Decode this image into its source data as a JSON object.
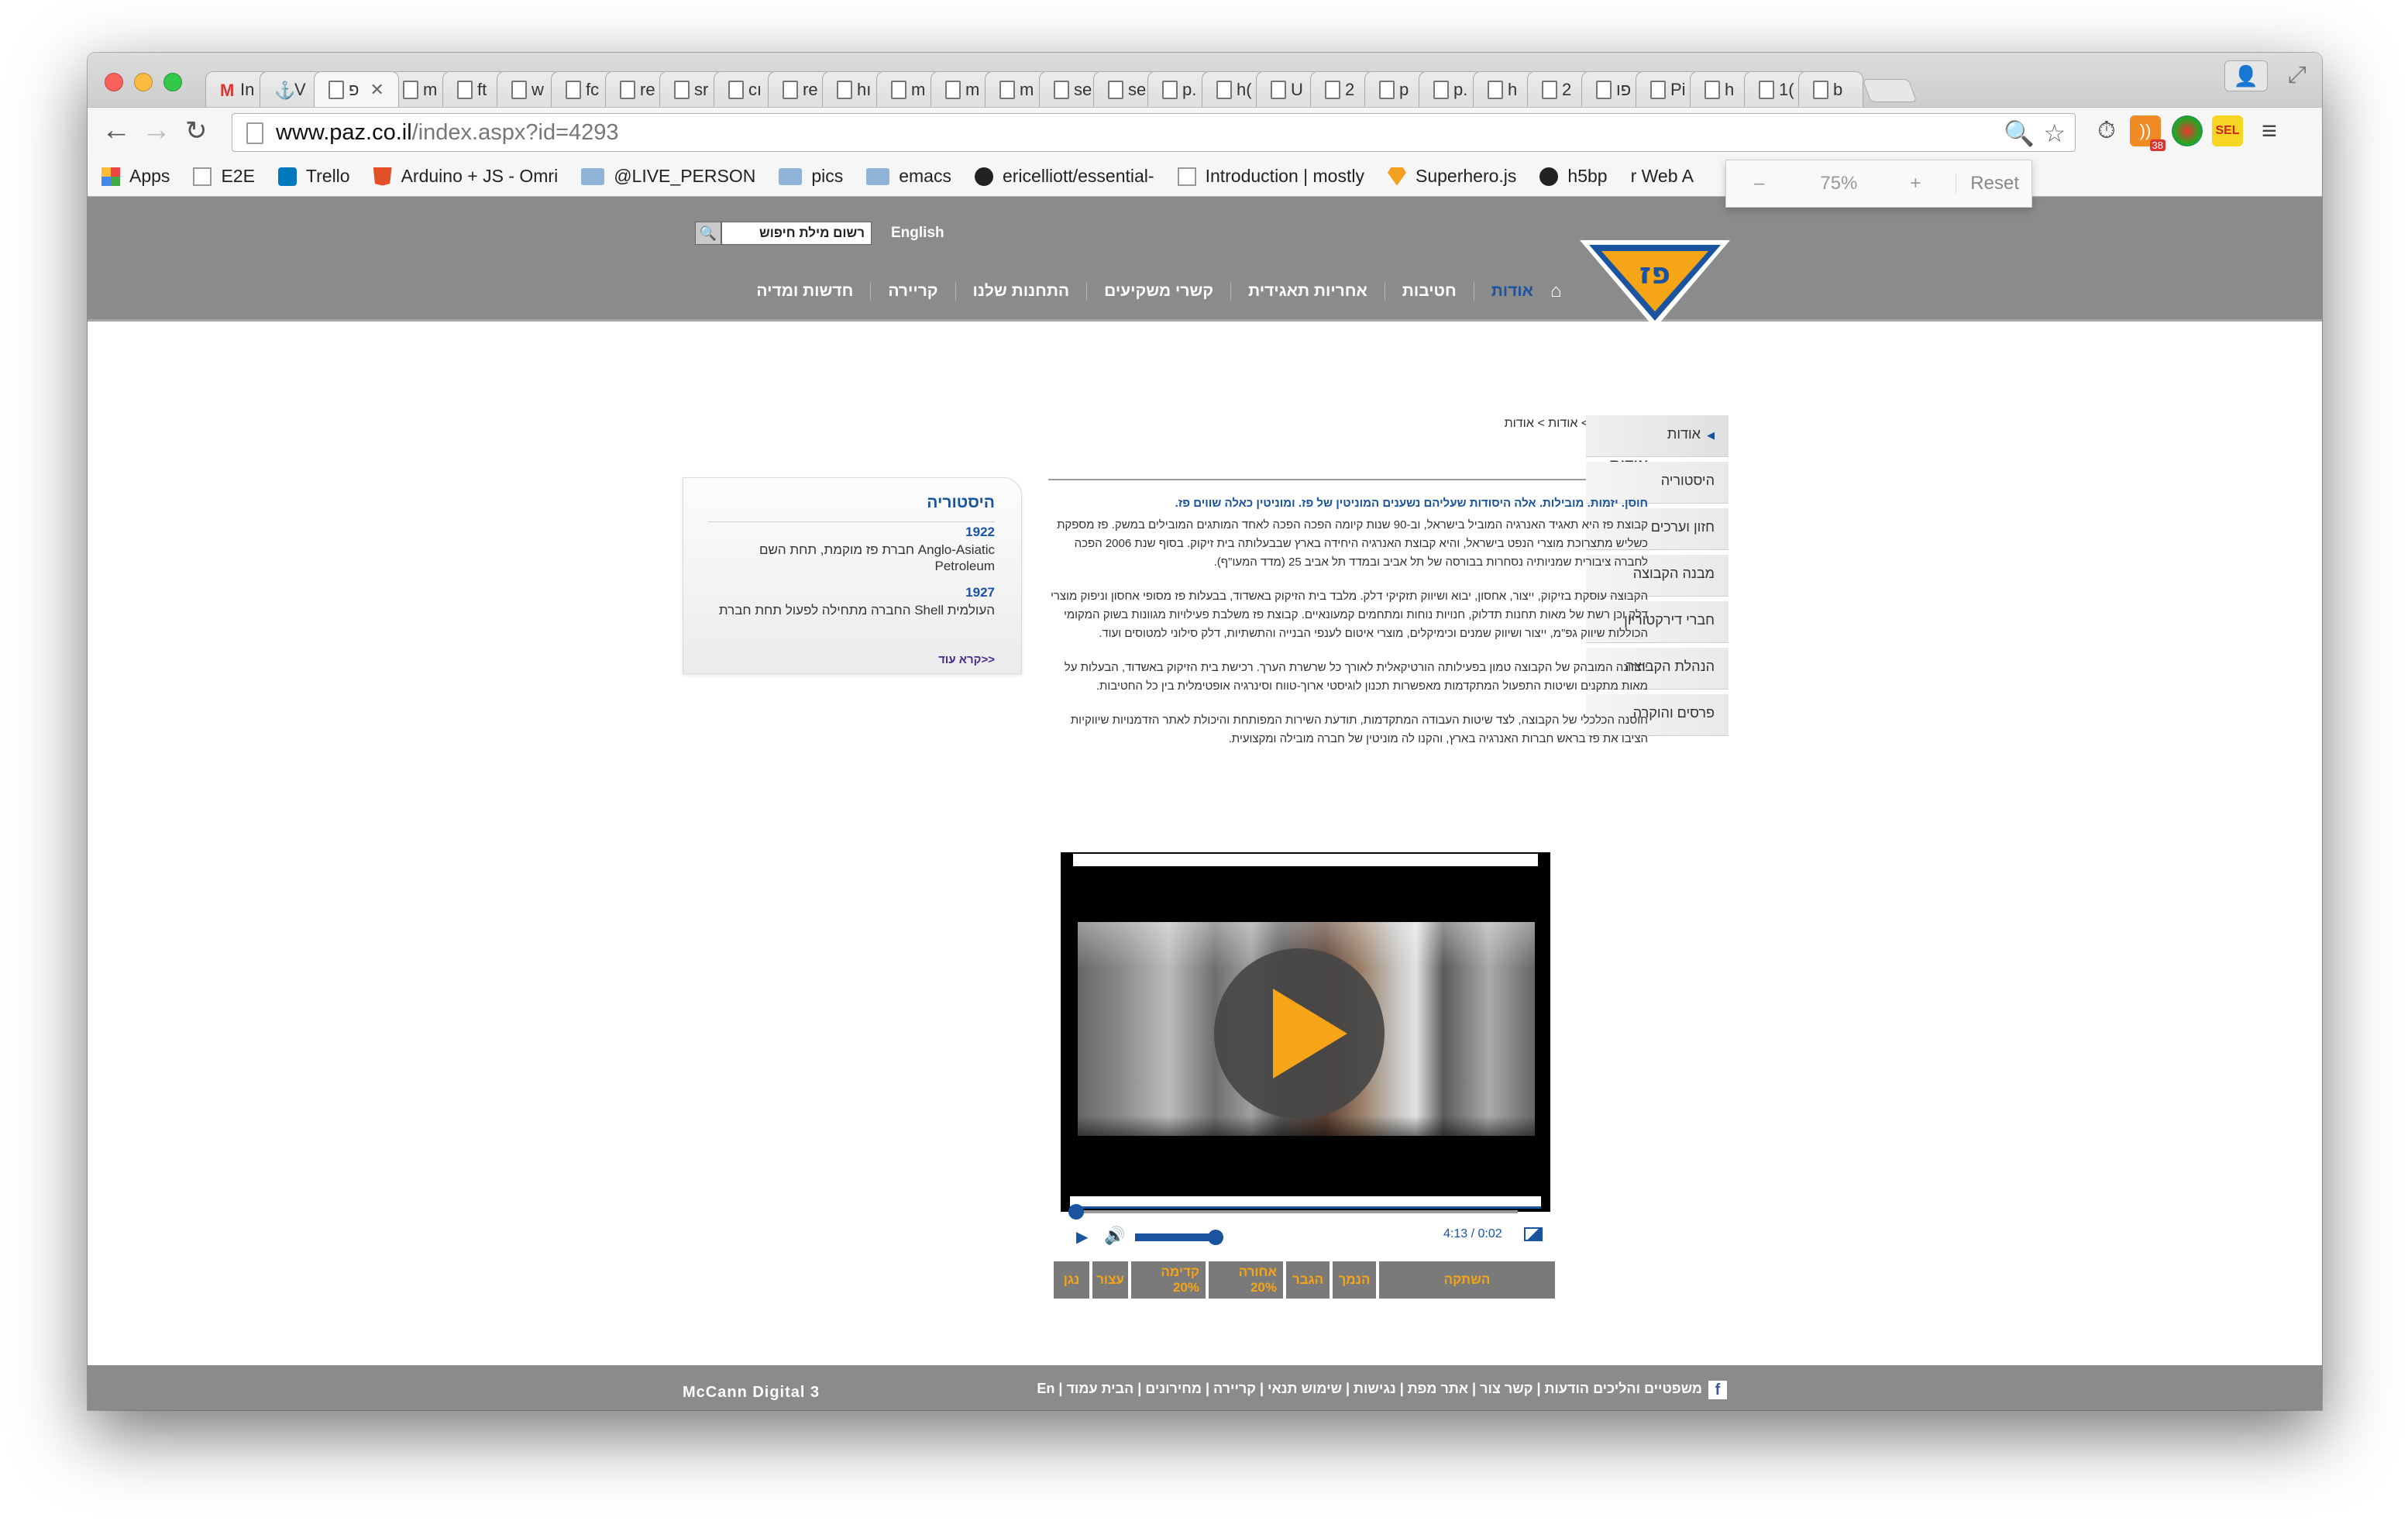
{
  "browser": {
    "tabs": [
      {
        "label": "In",
        "icon": "gmail-icon"
      },
      {
        "label": "V",
        "icon": "wanted-icon"
      },
      {
        "label": "פ",
        "icon": "page-icon",
        "active": true
      },
      {
        "label": "m",
        "icon": "page-icon"
      },
      {
        "label": "ft",
        "icon": "page-icon"
      },
      {
        "label": "w",
        "icon": "page-icon"
      },
      {
        "label": "fc",
        "icon": "page-icon"
      },
      {
        "label": "re",
        "icon": "page-icon"
      },
      {
        "label": "sr",
        "icon": "page-icon"
      },
      {
        "label": "cı",
        "icon": "page-icon"
      },
      {
        "label": "re",
        "icon": "page-icon"
      },
      {
        "label": "hı",
        "icon": "page-icon"
      },
      {
        "label": "m",
        "icon": "page-icon"
      },
      {
        "label": "m",
        "icon": "page-icon"
      },
      {
        "label": "m",
        "icon": "page-icon"
      },
      {
        "label": "se",
        "icon": "page-icon"
      },
      {
        "label": "se",
        "icon": "page-icon"
      },
      {
        "label": "p.",
        "icon": "page-icon"
      },
      {
        "label": "h(",
        "icon": "page-icon"
      },
      {
        "label": "U",
        "icon": "page-icon"
      },
      {
        "label": "2",
        "icon": "page-icon"
      },
      {
        "label": "p",
        "icon": "page-icon"
      },
      {
        "label": "p.",
        "icon": "page-icon"
      },
      {
        "label": "h",
        "icon": "page-icon"
      },
      {
        "label": "2",
        "icon": "page-icon"
      },
      {
        "label": "פו",
        "icon": "page-icon"
      },
      {
        "label": "Pi",
        "icon": "page-icon"
      },
      {
        "label": "h",
        "icon": "page-icon"
      },
      {
        "label": "1(",
        "icon": "page-icon"
      },
      {
        "label": "b",
        "icon": "page-icon"
      }
    ],
    "close_glyph": "✕",
    "url_host": "www.paz.co.il",
    "url_path": "/index.aspx?id=4293",
    "bookmarks": [
      {
        "label": "Apps",
        "icon": "apps-grid-icon"
      },
      {
        "label": "E2E",
        "icon": "page-icon"
      },
      {
        "label": "Trello",
        "icon": "trello-icon"
      },
      {
        "label": "Arduino + JS - Omri",
        "icon": "html5-icon"
      },
      {
        "label": "@LIVE_PERSON",
        "icon": "folder-icon"
      },
      {
        "label": "pics",
        "icon": "folder-icon"
      },
      {
        "label": "emacs",
        "icon": "folder-icon"
      },
      {
        "label": "ericelliott/essential-",
        "icon": "github-icon"
      },
      {
        "label": "Introduction | mostly",
        "icon": "book-icon"
      },
      {
        "label": "Superhero.js",
        "icon": "superhero-icon"
      },
      {
        "label": "h5bp",
        "icon": "github-icon"
      },
      {
        "label": "r Web A",
        "icon": ""
      }
    ],
    "zoom": {
      "minus": "–",
      "value": "75%",
      "plus": "+",
      "reset": "Reset"
    },
    "ext_badge": "38",
    "ext_sel": "SEL"
  },
  "site": {
    "colors": {
      "gray": "#8b8b8b",
      "blue": "#1a53a0",
      "yellow": "#f6a517"
    },
    "search_placeholder": "רשום מילת חיפוש",
    "english": "English",
    "logo_text": "פז",
    "nav": [
      {
        "label": "אודות",
        "active": true
      },
      {
        "label": "חטיבות"
      },
      {
        "label": "אחריות תאגידית"
      },
      {
        "label": "קשרי משקיעים"
      },
      {
        "label": "התחנות שלנו"
      },
      {
        "label": "קריירה"
      },
      {
        "label": "חדשות ומדיה"
      }
    ],
    "breadcrumb": "עמוד הבית > אודות > אודות",
    "page_title": "אודות",
    "sidebar": [
      {
        "label": "אודות",
        "active": true
      },
      {
        "label": "היסטוריה"
      },
      {
        "label": "חזון וערכים"
      },
      {
        "label": "מבנה הקבוצה"
      },
      {
        "label": "חברי דירקטוריון"
      },
      {
        "label": "הנהלת הקבוצה"
      },
      {
        "label": "פרסים והוקרה"
      }
    ],
    "article": {
      "lead": "חוסן. יזמות. מובילות. אלה היסודות שעליהם נשענים המוניטין של פז. ומוניטין כאלה שווים פז.",
      "paragraphs": [
        "קבוצת פז היא תאגיד האנרגיה המוביל בישראל, וב-90 שנות קיומה הפכה הפכה לאחד המותגים המובילים במשק. פז מספקת כשליש מתצרוכת מוצרי הנפט בישראל, והיא קבוצת האנרגיה היחידה בארץ שבבעלותה בית זיקוק. בסוף שנת 2006 הפכה לחברה ציבורית שמניותיה נסחרות בבורסה של תל אביב ובמדד תל אביב 25 (מדד המעו\"ף).",
        "הקבוצה עוסקת בזיקוק, ייצור, אחסון, יבוא ושיווק תזקיקי דלק. מלבד בית הזיקוק באשדוד, בבעלות פז מסופי אחסון וניפוק מוצרי דלק וכן רשת של מאות תחנות תדלוק, חנויות נוחות ומתחמים קמעונאיים. קבוצת פז משלבת פעילויות מגוונות בשוק המקומי הכוללות שיווק גפ\"מ, ייצור ושיווק שמנים וכימיקלים, מוצרי איטום לענפי הבנייה והתשתיות, דלק סילוני למטוסים ועוד.",
        "יתרונה המובהק של הקבוצה טמון בפעילותה הורטיקאלית לאורך כל שרשרת הערך. רכישת בית הזיקוק באשדוד, הבעלות על מאות מתקנים ושיטות התפעול המתקדמות מאפשרות תכנון לוגיסטי ארוך-טווח וסינרגיה אופטימלית בין כל החטיבות.",
        "חוסנה הכלכלי של הקבוצה, לצד שיטות העבודה המתקדמות, תודעת השירות המפותחת והיכולת לאתר הזדמנויות שיווקיות הציבו את פז בראש חברות האנרגיה בארץ, והקנו לה מוניטין של חברה מובילה ומקצועית."
      ]
    },
    "history_box": {
      "title": "היסטוריה",
      "entries": [
        {
          "year": "1922",
          "text": "חברת פז מוקמת, תחת השם Anglo-Asiatic Petroleum"
        },
        {
          "year": "1927",
          "text": "החברה מתחילה לפעול תחת חברת Shell העולמית"
        }
      ],
      "more": "קרא עוד>>"
    },
    "video": {
      "time": "4:13 / 0:02",
      "progress": 0.0,
      "volume": 0.85,
      "buttons": [
        "נגן",
        "עצור",
        "קדימה 20%",
        "אחורה 20%",
        "הגבר",
        "הנמך",
        "השתקה"
      ]
    },
    "footer": {
      "credit": "McCann Digital 3",
      "links": "משפטיים והליכים הודעות | קשר צור | אתר מפת | נגישות | שימוש תנאי | קריירה | מחירונים | הבית עמוד | En",
      "facebook": "f"
    }
  }
}
